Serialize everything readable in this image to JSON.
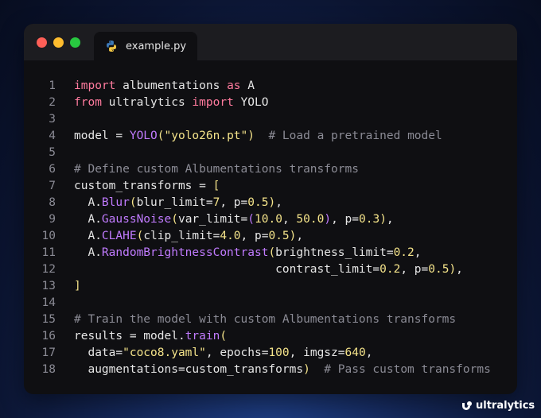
{
  "tab": {
    "filename": "example.py",
    "icon": "python-icon"
  },
  "window_controls": {
    "close_color": "#fe5f57",
    "minimize_color": "#febc2e",
    "maximize_color": "#28c840"
  },
  "code": {
    "lines": [
      {
        "num": "1",
        "tokens": [
          {
            "t": "import",
            "c": "kw"
          },
          {
            "t": " albumentations ",
            "c": ""
          },
          {
            "t": "as",
            "c": "kw"
          },
          {
            "t": " A",
            "c": ""
          }
        ]
      },
      {
        "num": "2",
        "tokens": [
          {
            "t": "from",
            "c": "kw"
          },
          {
            "t": " ultralytics ",
            "c": ""
          },
          {
            "t": "import",
            "c": "kw"
          },
          {
            "t": " YOLO",
            "c": ""
          }
        ]
      },
      {
        "num": "3",
        "tokens": []
      },
      {
        "num": "4",
        "tokens": [
          {
            "t": "model = ",
            "c": ""
          },
          {
            "t": "YOLO",
            "c": "fn"
          },
          {
            "t": "(",
            "c": "brace"
          },
          {
            "t": "\"yolo26n.pt\"",
            "c": "str"
          },
          {
            "t": ")",
            "c": "brace"
          },
          {
            "t": "  ",
            "c": ""
          },
          {
            "t": "# Load a pretrained model",
            "c": "cm"
          }
        ]
      },
      {
        "num": "5",
        "tokens": []
      },
      {
        "num": "6",
        "tokens": [
          {
            "t": "# Define custom Albumentations transforms",
            "c": "cm"
          }
        ]
      },
      {
        "num": "7",
        "tokens": [
          {
            "t": "custom_transforms = ",
            "c": ""
          },
          {
            "t": "[",
            "c": "brace"
          }
        ]
      },
      {
        "num": "8",
        "tokens": [
          {
            "t": "  A.",
            "c": ""
          },
          {
            "t": "Blur",
            "c": "fn"
          },
          {
            "t": "(",
            "c": "brace"
          },
          {
            "t": "blur_limit=",
            "c": ""
          },
          {
            "t": "7",
            "c": "num"
          },
          {
            "t": ", p=",
            "c": ""
          },
          {
            "t": "0.5",
            "c": "num"
          },
          {
            "t": ")",
            "c": "brace"
          },
          {
            "t": ",",
            "c": ""
          }
        ]
      },
      {
        "num": "9",
        "tokens": [
          {
            "t": "  A.",
            "c": ""
          },
          {
            "t": "GaussNoise",
            "c": "fn"
          },
          {
            "t": "(",
            "c": "brace"
          },
          {
            "t": "var_limit=",
            "c": ""
          },
          {
            "t": "(",
            "c": "fn"
          },
          {
            "t": "10.0",
            "c": "num"
          },
          {
            "t": ", ",
            "c": ""
          },
          {
            "t": "50.0",
            "c": "num"
          },
          {
            "t": ")",
            "c": "fn"
          },
          {
            "t": ", p=",
            "c": ""
          },
          {
            "t": "0.3",
            "c": "num"
          },
          {
            "t": ")",
            "c": "brace"
          },
          {
            "t": ",",
            "c": ""
          }
        ]
      },
      {
        "num": "10",
        "tokens": [
          {
            "t": "  A.",
            "c": ""
          },
          {
            "t": "CLAHE",
            "c": "fn"
          },
          {
            "t": "(",
            "c": "brace"
          },
          {
            "t": "clip_limit=",
            "c": ""
          },
          {
            "t": "4.0",
            "c": "num"
          },
          {
            "t": ", p=",
            "c": ""
          },
          {
            "t": "0.5",
            "c": "num"
          },
          {
            "t": ")",
            "c": "brace"
          },
          {
            "t": ",",
            "c": ""
          }
        ]
      },
      {
        "num": "11",
        "tokens": [
          {
            "t": "  A.",
            "c": ""
          },
          {
            "t": "RandomBrightnessContrast",
            "c": "fn"
          },
          {
            "t": "(",
            "c": "brace"
          },
          {
            "t": "brightness_limit=",
            "c": ""
          },
          {
            "t": "0.2",
            "c": "num"
          },
          {
            "t": ",",
            "c": ""
          }
        ]
      },
      {
        "num": "12",
        "tokens": [
          {
            "t": "                             contrast_limit=",
            "c": ""
          },
          {
            "t": "0.2",
            "c": "num"
          },
          {
            "t": ", p=",
            "c": ""
          },
          {
            "t": "0.5",
            "c": "num"
          },
          {
            "t": ")",
            "c": "brace"
          },
          {
            "t": ",",
            "c": ""
          }
        ]
      },
      {
        "num": "13",
        "tokens": [
          {
            "t": "]",
            "c": "brace"
          }
        ]
      },
      {
        "num": "14",
        "tokens": []
      },
      {
        "num": "15",
        "tokens": [
          {
            "t": "# Train the model with custom Albumentations transforms",
            "c": "cm"
          }
        ]
      },
      {
        "num": "16",
        "tokens": [
          {
            "t": "results = model.",
            "c": ""
          },
          {
            "t": "train",
            "c": "fn"
          },
          {
            "t": "(",
            "c": "brace"
          }
        ]
      },
      {
        "num": "17",
        "tokens": [
          {
            "t": "  data=",
            "c": ""
          },
          {
            "t": "\"coco8.yaml\"",
            "c": "str"
          },
          {
            "t": ", epochs=",
            "c": ""
          },
          {
            "t": "100",
            "c": "num"
          },
          {
            "t": ", imgsz=",
            "c": ""
          },
          {
            "t": "640",
            "c": "num"
          },
          {
            "t": ",",
            "c": ""
          }
        ]
      },
      {
        "num": "18",
        "tokens": [
          {
            "t": "  augmentations=custom_transforms",
            "c": ""
          },
          {
            "t": ")",
            "c": "brace"
          },
          {
            "t": "  ",
            "c": ""
          },
          {
            "t": "# Pass custom transforms",
            "c": "cm"
          }
        ]
      }
    ]
  },
  "brand": {
    "name": "ultralytics",
    "icon": "ultralytics-logo-icon"
  }
}
